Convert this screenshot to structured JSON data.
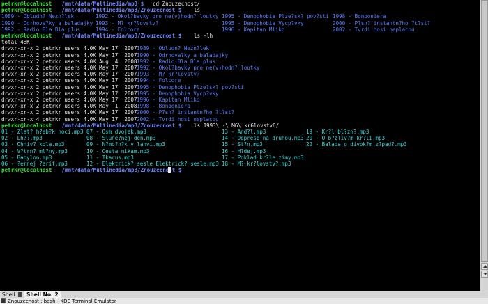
{
  "window": {
    "title": "Znouzecnost : bash - KDE Terminal Emulator",
    "tabs": [
      {
        "label": "Shell"
      },
      {
        "label": "Shell No. 2"
      }
    ]
  },
  "terminal": {
    "lines": [
      {
        "segs": [
          [
            "petrkr@localhost",
            "c-green",
            0
          ],
          [
            " /mnt/data/Multinedia/mp3 $ ",
            "c-bblue",
            82
          ],
          [
            "cd Znouzecnost/",
            "c-white",
            217
          ]
        ]
      },
      {
        "segs": [
          [
            "petrkr@localhost",
            "c-green",
            0
          ],
          [
            " /mnt/data/Multinedia/mp3/Znouzecnost $ ",
            "c-bblue",
            82
          ],
          [
            "ls",
            "c-white",
            276
          ]
        ]
      },
      {
        "segs": [
          [
            "1989 - Obludn? Nezn?lek",
            "c-blue",
            0
          ],
          [
            "1992 - Okol?bavky pro ne(v)hodn? loutky",
            "c-blue",
            135
          ],
          [
            "1995 - Denophobia Plze?sk? pov?sti",
            "c-blue",
            316
          ],
          [
            "1998 - Bonboniera",
            "c-blue",
            475
          ]
        ]
      },
      {
        "segs": [
          [
            "1990 - Odrhova?ky a baladajky",
            "c-blue",
            0
          ],
          [
            "1993 - M? kr?lovstv?",
            "c-blue",
            135
          ],
          [
            "1995 - Denophobia Vycp?vky",
            "c-blue",
            316
          ],
          [
            "2000 - P?sn? instantn?ho ?t?st?",
            "c-blue",
            475
          ]
        ]
      },
      {
        "segs": [
          [
            "1992 - Radio Bla Bla plus",
            "c-blue",
            0
          ],
          [
            "1994 - Folcore",
            "c-blue",
            135
          ],
          [
            "1996 - Kapitan Mliko",
            "c-blue",
            316
          ],
          [
            "2002 - Tvrdi hosi neplacou",
            "c-blue",
            475
          ]
        ]
      },
      {
        "segs": [
          [
            "petrkr@localhost",
            "c-green",
            0
          ],
          [
            " /mnt/data/Multinedia/mp3/Znouzecnost $ ",
            "c-bblue",
            82
          ],
          [
            "ls -lh",
            "c-white",
            276
          ]
        ]
      },
      {
        "segs": [
          [
            "total 48K",
            "c-white",
            0
          ]
        ]
      },
      {
        "segs": [
          [
            "drwxr-xr-x 2 petrkr users 4.0K May 17  2007 ",
            "c-white",
            0
          ],
          [
            "1989 - Obludn? Nezn?lek",
            "c-blue",
            194
          ]
        ]
      },
      {
        "segs": [
          [
            "drwxr-xr-x 2 petrkr users 4.0K May 17  2007 ",
            "c-white",
            0
          ],
          [
            "1990 - Odrhova?ky a baladajky",
            "c-blue",
            194
          ]
        ]
      },
      {
        "segs": [
          [
            "drwxr-xr-x 2 petrkr users 4.0K Aug  4  2008 ",
            "c-white",
            0
          ],
          [
            "1992 - Radio Bla Bla plus",
            "c-blue",
            194
          ]
        ]
      },
      {
        "segs": [
          [
            "drwxr-xr-x 2 petrkr users 4.0K May 17  2007 ",
            "c-white",
            0
          ],
          [
            "1992 - Okol?bavky pro ne(v)hodn? loutky",
            "c-blue",
            194
          ]
        ]
      },
      {
        "segs": [
          [
            "drwxr-xr-x 2 petrkr users 4.0K May 17  2007 ",
            "c-white",
            0
          ],
          [
            "1993 - M? kr?lovstv?",
            "c-blue",
            194
          ]
        ]
      },
      {
        "segs": [
          [
            "drwxr-xr-x 2 petrkr users 4.0K May 17  2007 ",
            "c-white",
            0
          ],
          [
            "1994 - Folcore",
            "c-blue",
            194
          ]
        ]
      },
      {
        "segs": [
          [
            "drwxr-xr-x 2 petrkr users 4.0K May 17  2007 ",
            "c-white",
            0
          ],
          [
            "1995 - Denophobia Plze?sk? pov?sti",
            "c-blue",
            194
          ]
        ]
      },
      {
        "segs": [
          [
            "drwxr-xr-x 2 petrkr users 4.0K May 17  2007 ",
            "c-white",
            0
          ],
          [
            "1995 - Denophobia Vycp?vky",
            "c-blue",
            194
          ]
        ]
      },
      {
        "segs": [
          [
            "drwxr-xr-x 2 petrkr users 4.0K May 17  2007 ",
            "c-white",
            0
          ],
          [
            "1996 - Kapitan Mliko",
            "c-blue",
            194
          ]
        ]
      },
      {
        "segs": [
          [
            "drwxr-xr-x 2 petrkr users 4.0K May  1  2008 ",
            "c-white",
            0
          ],
          [
            "1998 - Bonboniera",
            "c-blue",
            194
          ]
        ]
      },
      {
        "segs": [
          [
            "drwxr-xr-x 2 petrkr users 4.0K May 17  2007 ",
            "c-white",
            0
          ],
          [
            "2000 - P?sn? instantn?ho ?t?st?",
            "c-blue",
            194
          ]
        ]
      },
      {
        "segs": [
          [
            "drwxr-xr-x 4 petrkr users 4.0K May 17  2007 ",
            "c-white",
            0
          ],
          [
            "2002 - Tvrdi hosi neplacou",
            "c-blue",
            194
          ]
        ]
      },
      {
        "segs": [
          [
            "petrkr@localhost",
            "c-green",
            0
          ],
          [
            " /mnt/data/Multinedia/mp3/Znouzecnost $ ",
            "c-bblue",
            82
          ],
          [
            "ls 1993\\ -\\ M6\\ kr6lovstv6/",
            "c-white",
            276
          ]
        ]
      },
      {
        "segs": [
          [
            "01 - Zlat? h?eb?k noci.mp3",
            "c-cyan",
            0
          ],
          [
            "07 - Osm dvojek.mp3",
            "c-cyan",
            122
          ],
          [
            "13 - And?l.mp3",
            "c-cyan",
            316
          ],
          [
            "19 - Kr?l bl?zn?.mp3",
            "c-cyan",
            437
          ]
        ]
      },
      {
        "segs": [
          [
            "02 - Lh??.mp3",
            "c-cyan",
            0
          ],
          [
            "08 - Slune?nej den.mp3",
            "c-cyan",
            122
          ],
          [
            "14 - Deprese na druhou.mp3",
            "c-cyan",
            316
          ],
          [
            "20 - O b?zliv?m kr?li.mp3",
            "c-cyan",
            437
          ]
        ]
      },
      {
        "segs": [
          [
            "03 - Ohniv? kola.mp3",
            "c-cyan",
            0
          ],
          [
            "09 - N?mo?n?k v lahvi.mp3",
            "c-cyan",
            122
          ],
          [
            "15 - St?n.mp3",
            "c-cyan",
            316
          ],
          [
            "22 - Balada o divok?m z?pad?.mp3",
            "c-cyan",
            437
          ]
        ]
      },
      {
        "segs": [
          [
            "04 - V?trn? ml?ny.mp3",
            "c-cyan",
            0
          ],
          [
            "10 - Cesta nikam.mp3",
            "c-cyan",
            122
          ],
          [
            "16 - H?dej.mp3",
            "c-cyan",
            316
          ]
        ]
      },
      {
        "segs": [
          [
            "05 - Babylon.mp3",
            "c-cyan",
            0
          ],
          [
            "11 - Ikarus.mp3",
            "c-cyan",
            122
          ],
          [
            "17 - Poklad kr?le zimy.mp3",
            "c-cyan",
            316
          ]
        ]
      },
      {
        "segs": [
          [
            "06 - ?ernej ?erif.mp3",
            "c-cyan",
            0
          ],
          [
            "12 - Elektrick? sesle Elektrick? sesle.mp3",
            "c-cyan",
            122
          ],
          [
            "18 - M? kr?lovstv?.mp3",
            "c-cyan",
            316
          ]
        ]
      },
      {
        "segs": [
          [
            "petrkr@localhost",
            "c-green",
            0
          ],
          [
            " /mnt/data/Multinedia/mp3/Znouzecnost $ ",
            "c-bblue",
            82
          ]
        ],
        "cursor": true
      }
    ]
  }
}
